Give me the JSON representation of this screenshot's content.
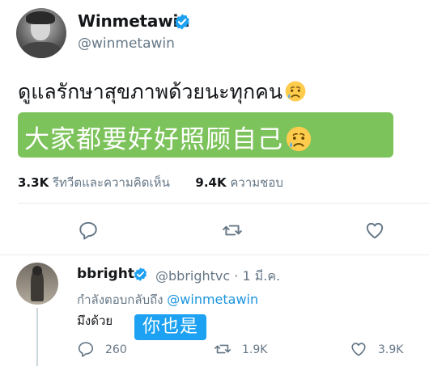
{
  "main_tweet": {
    "display_name": "Winmetawin",
    "handle": "@winmetawin",
    "text": "ดูแลรักษาสุขภาพด้วยนะทุกคน",
    "translation": "大家都要好好照顾自己",
    "stats": {
      "retweets_count": "3.3K",
      "retweets_label": "รีทวีตและความคิดเห็น",
      "likes_count": "9.4K",
      "likes_label": "ความชอบ"
    }
  },
  "reply": {
    "display_name": "bbright",
    "handle": "@bbrightvc",
    "separator": "·",
    "date": "1 มี.ค.",
    "replying_prefix": "กำลังตอบกลับถึง",
    "replying_to": "@winmetawin",
    "text": "มึงด้วย",
    "translation": "你也是",
    "reply_count": "260",
    "retweet_count": "1.9K",
    "like_count": "3.9K"
  },
  "colors": {
    "verified": "#1da1f2",
    "translation_green": "#7dc35b",
    "translation_blue": "#1da1f2",
    "mention": "#1b95e0",
    "secondary_text": "#657786"
  },
  "icons": [
    "verified-badge-icon",
    "crying-emoji-icon",
    "reply-icon",
    "retweet-icon",
    "like-icon"
  ]
}
